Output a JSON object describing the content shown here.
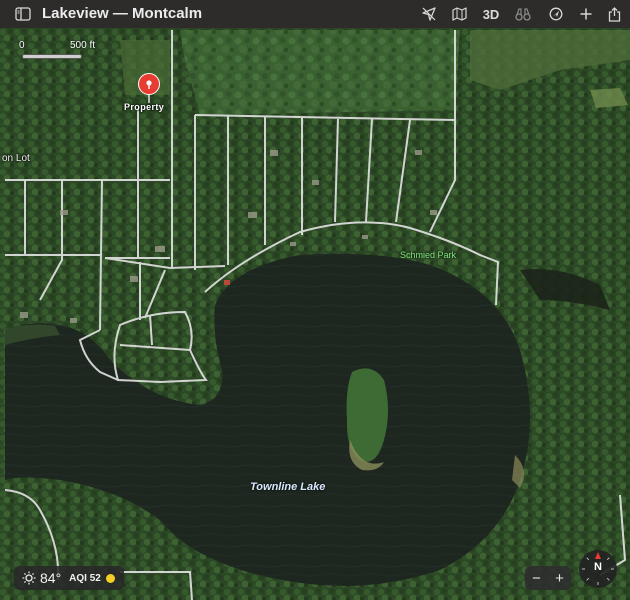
{
  "window": {
    "title": "Lakeview — Montcalm"
  },
  "toolbar": {
    "sidebar_icon": "sidebar-icon",
    "location_icon": "location-arrow-icon",
    "map_mode_icon": "map-icon",
    "three_d_label": "3D",
    "binoculars_icon": "binoculars-icon",
    "tracking_icon": "tracking-icon",
    "add_icon": "plus-icon",
    "share_icon": "share-icon"
  },
  "map": {
    "scale": {
      "start": "0",
      "end": "500 ft"
    },
    "pin": {
      "label": "Property",
      "color": "#e83b32"
    },
    "labels": {
      "place_partial": "on Lot",
      "park": "Schmied Park",
      "lake": "Townline Lake"
    }
  },
  "weather": {
    "temperature": "84°",
    "aqi_label": "AQI 52",
    "aqi_color": "#f5cf27"
  },
  "zoom": {
    "minus": "−",
    "plus": "+"
  },
  "compass": {
    "label": "N"
  }
}
